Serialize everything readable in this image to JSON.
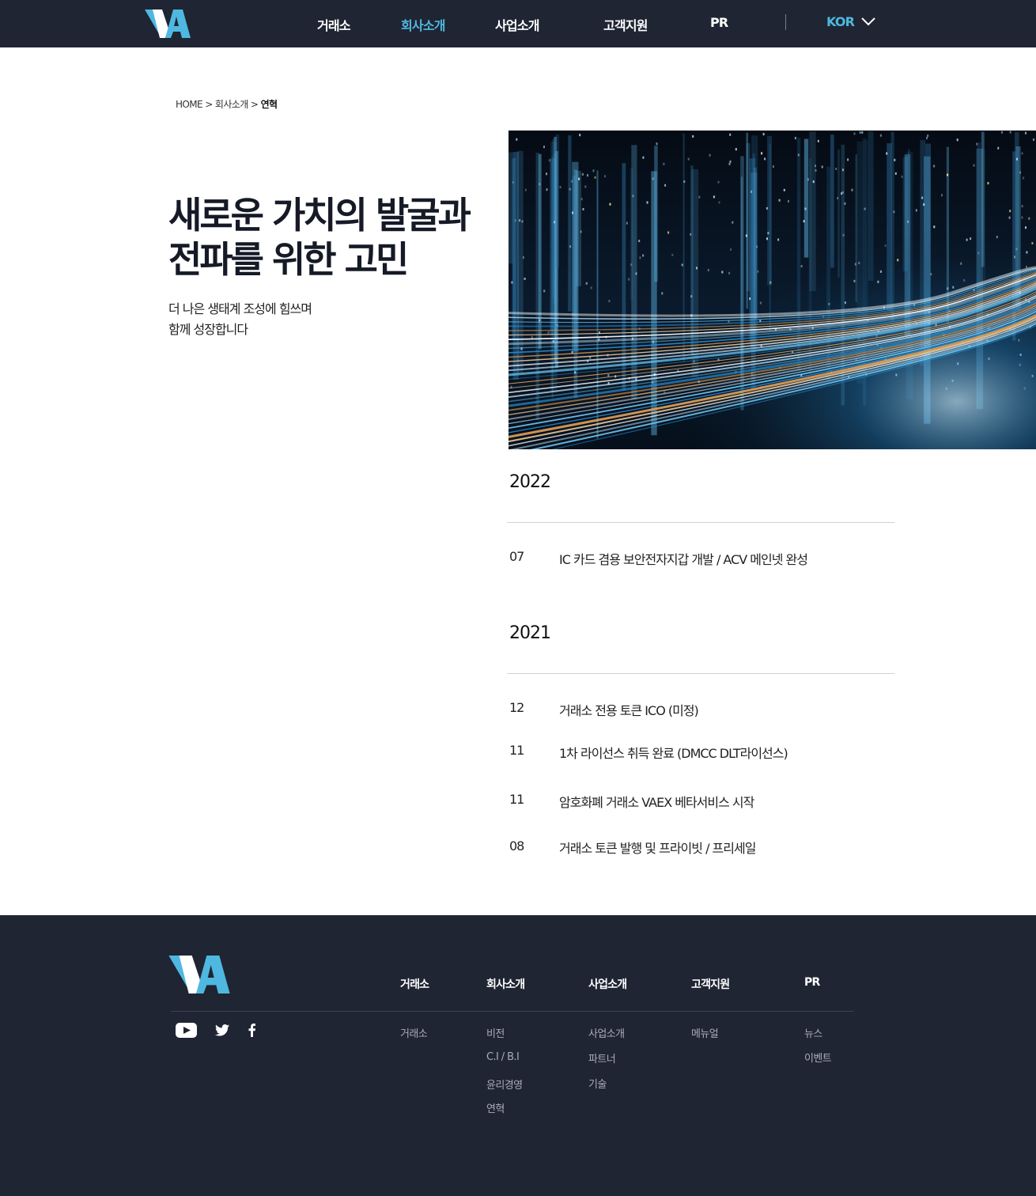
{
  "header": {
    "logo_text": "VA",
    "nav": [
      {
        "label": "거래소",
        "active": false
      },
      {
        "label": "회사소개",
        "active": true
      },
      {
        "label": "사업소개",
        "active": false
      },
      {
        "label": "고객지원",
        "active": false
      },
      {
        "label": "PR",
        "active": false
      }
    ],
    "language": "KOR"
  },
  "breadcrumb": {
    "home": "HOME",
    "sep1": ">",
    "parent": "회사소개",
    "sep2": ">",
    "current": "연혁"
  },
  "hero": {
    "title_line1": "새로운 가치의 발굴과",
    "title_line2": "전파를 위한 고민",
    "subtitle_line1": "더 나은 생태계 조성에 힘쓰며",
    "subtitle_line2": "함께 성장합니다"
  },
  "timeline": [
    {
      "year": "2022",
      "items": [
        {
          "month": "07",
          "text": "IC 카드 겸용 보안전자지갑 개발 / ACV 메인넷 완성"
        }
      ]
    },
    {
      "year": "2021",
      "items": [
        {
          "month": "12",
          "text": "거래소 전용 토큰 ICO (미정)"
        },
        {
          "month": "11",
          "text": "1차 라이선스 취득 완료 (DMCC DLT라이선스)"
        },
        {
          "month": "11",
          "text": "암호화폐 거래소 VAEX 베타서비스 시작"
        },
        {
          "month": "08",
          "text": "거래소 토큰 발행 및 프라이빗 / 프리세일"
        }
      ]
    }
  ],
  "footer": {
    "social": [
      "youtube-icon",
      "twitter-icon",
      "facebook-icon"
    ],
    "columns": [
      {
        "heading": "거래소",
        "links": [
          "거래소"
        ]
      },
      {
        "heading": "회사소개",
        "links": [
          "비전",
          "C.I / B.I",
          "윤리경영",
          "연혁"
        ]
      },
      {
        "heading": "사업소개",
        "links": [
          "사업소개",
          "파트너",
          "기술"
        ]
      },
      {
        "heading": "고객지원",
        "links": [
          "메뉴얼"
        ]
      },
      {
        "heading": "PR",
        "links": [
          "뉴스",
          "이벤트"
        ]
      }
    ]
  },
  "colors": {
    "header_bg": "#1f2533",
    "accent": "#4fb8e0",
    "text_dark": "#151a26"
  }
}
